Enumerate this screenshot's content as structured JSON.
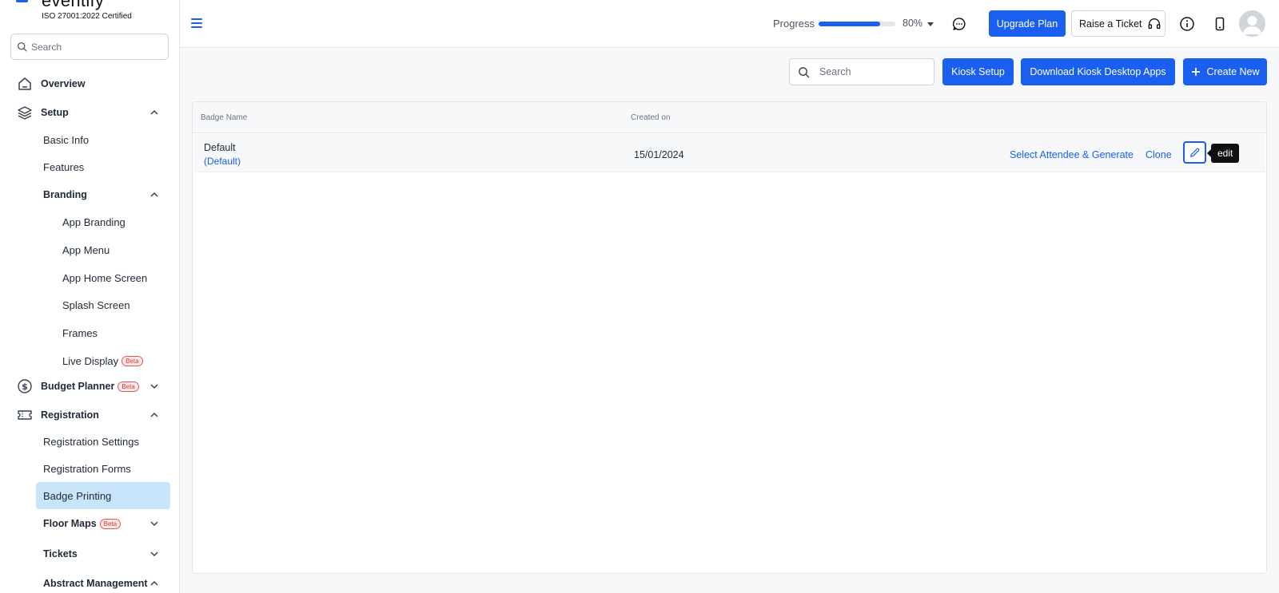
{
  "brand": {
    "name": "eventify",
    "certification": "ISO 27001:2022 Certified",
    "accent": "#1a5ff0"
  },
  "sidebar": {
    "search_placeholder": "Search",
    "beta_label": "Beta",
    "items": {
      "overview": "Overview",
      "setup": "Setup",
      "basic_info": "Basic Info",
      "features": "Features",
      "branding": "Branding",
      "app_branding": "App Branding",
      "app_menu": "App Menu",
      "app_home_screen": "App Home Screen",
      "splash_screen": "Splash Screen",
      "frames": "Frames",
      "live_display": "Live Display",
      "budget_planner": "Budget Planner",
      "registration": "Registration",
      "registration_settings": "Registration Settings",
      "registration_forms": "Registration Forms",
      "badge_printing": "Badge Printing",
      "floor_maps": "Floor Maps",
      "tickets": "Tickets",
      "abstract_management": "Abstract Management"
    }
  },
  "header": {
    "progress_label": "Progress",
    "progress_value": 80,
    "progress_text": "80%",
    "upgrade_label": "Upgrade Plan",
    "ticket_label": "Raise a Ticket"
  },
  "toolbar": {
    "search_placeholder": "Search",
    "kiosk_setup": "Kiosk Setup",
    "download_kiosk": "Download Kiosk Desktop Apps",
    "create_new": "Create New"
  },
  "table": {
    "headers": {
      "badge_name": "Badge Name",
      "created_on": "Created on"
    },
    "rows": [
      {
        "name": "Default",
        "tag": "(Default)",
        "created_on": "15/01/2024",
        "select_action": "Select Attendee & Generate",
        "clone_action": "Clone",
        "edit_tooltip": "edit"
      }
    ]
  }
}
